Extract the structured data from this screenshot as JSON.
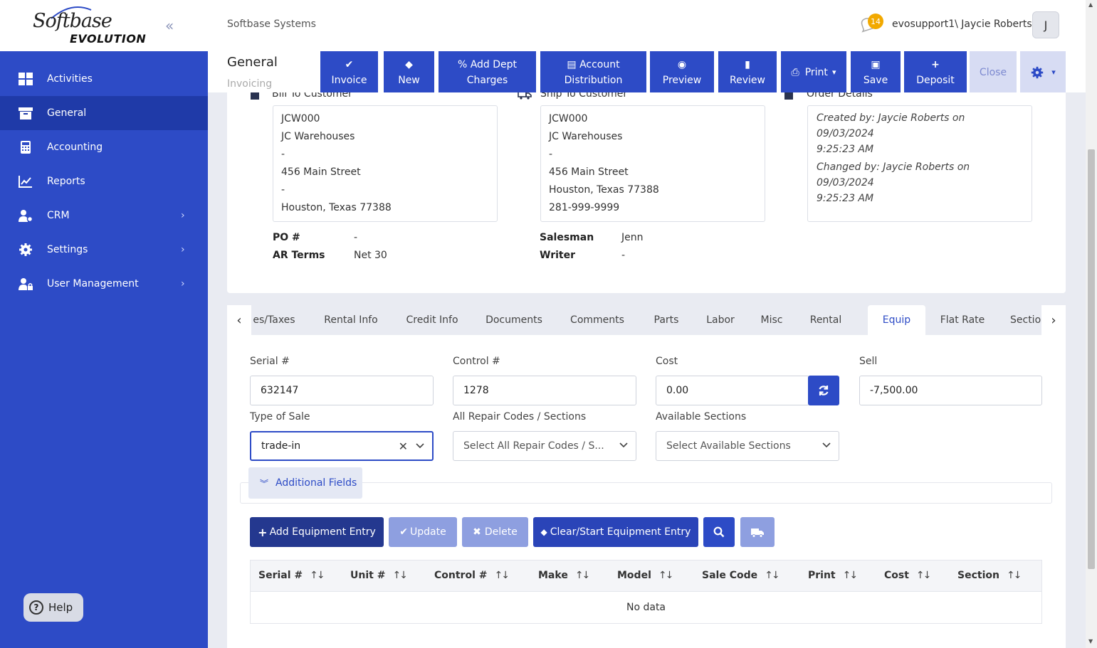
{
  "brand": {
    "line1": "Softbase",
    "line2": "EVOLUTION"
  },
  "sidebar": {
    "items": [
      {
        "label": "Activities"
      },
      {
        "label": "General"
      },
      {
        "label": "Accounting"
      },
      {
        "label": "Reports"
      },
      {
        "label": "CRM"
      },
      {
        "label": "Settings"
      },
      {
        "label": "User Management"
      }
    ],
    "help_label": "Help"
  },
  "header": {
    "company": "Softbase Systems",
    "notification_count": "14",
    "user": "evosupport1\\ Jaycie Roberts",
    "avatar_initial": "J"
  },
  "subheader": {
    "title": "General",
    "subtitle": "Invoicing"
  },
  "toolbar": {
    "invoice": "Invoice",
    "new": "New",
    "add_dept_1": "Add Dept",
    "add_dept_2": "Charges",
    "account_1": "Account",
    "account_2": "Distribution",
    "preview": "Preview",
    "review": "Review",
    "print": "Print",
    "save": "Save",
    "deposit": "Deposit",
    "close": "Close"
  },
  "bill_to": {
    "title": "Bill To Customer",
    "lines": [
      "JCW000",
      "JC Warehouses",
      "-",
      "456 Main Street",
      "-",
      "Houston, Texas 77388"
    ]
  },
  "ship_to": {
    "title": "Ship To Customer",
    "lines": [
      "JCW000",
      "JC Warehouses",
      "-",
      "456 Main Street",
      "Houston, Texas 77388",
      "281-999-9999"
    ]
  },
  "order_details": {
    "title": "Order Details",
    "created_1": "Created by: Jaycie Roberts on 09/03/2024",
    "created_2": "9:25:23 AM",
    "changed_1": "Changed by: Jaycie Roberts on 09/03/2024",
    "changed_2": "9:25:23 AM"
  },
  "info": {
    "po_label": "PO #",
    "po_value": "-",
    "terms_label": "AR Terms",
    "terms_value": "Net 30",
    "salesman_label": "Salesman",
    "salesman_value": "Jenn",
    "writer_label": "Writer",
    "writer_value": "-"
  },
  "tabs": [
    {
      "label": "es/Taxes"
    },
    {
      "label": "Rental Info"
    },
    {
      "label": "Credit Info"
    },
    {
      "label": "Documents"
    },
    {
      "label": "Comments"
    },
    {
      "label": "Parts"
    },
    {
      "label": "Labor"
    },
    {
      "label": "Misc"
    },
    {
      "label": "Rental"
    },
    {
      "label": "Equip"
    },
    {
      "label": "Flat Rate"
    },
    {
      "label": "Sectio"
    }
  ],
  "form": {
    "serial_label": "Serial #",
    "serial_value": "632147",
    "control_label": "Control #",
    "control_value": "1278",
    "cost_label": "Cost",
    "cost_value": "0.00",
    "sell_label": "Sell",
    "sell_value": "-7,500.00",
    "type_label": "Type of Sale",
    "type_value": "trade-in",
    "repair_label": "All Repair Codes / Sections",
    "repair_placeholder": "Select All Repair Codes / S...",
    "avail_label": "Available Sections",
    "avail_placeholder": "Select Available Sections",
    "additional_fields": "Additional Fields"
  },
  "actions": {
    "add": "Add Equipment Entry",
    "update": "Update",
    "delete": "Delete",
    "clear": "Clear/Start Equipment Entry"
  },
  "grid": {
    "columns": [
      "Serial #",
      "Unit #",
      "Control #",
      "Make",
      "Model",
      "Sale Code",
      "Print",
      "Cost",
      "Section"
    ],
    "empty": "No data"
  },
  "colors": {
    "primary": "#2d4bc6",
    "sidebar": "#2d4bc6",
    "active_nav": "#1f3aa8",
    "badge": "#f2a900"
  }
}
